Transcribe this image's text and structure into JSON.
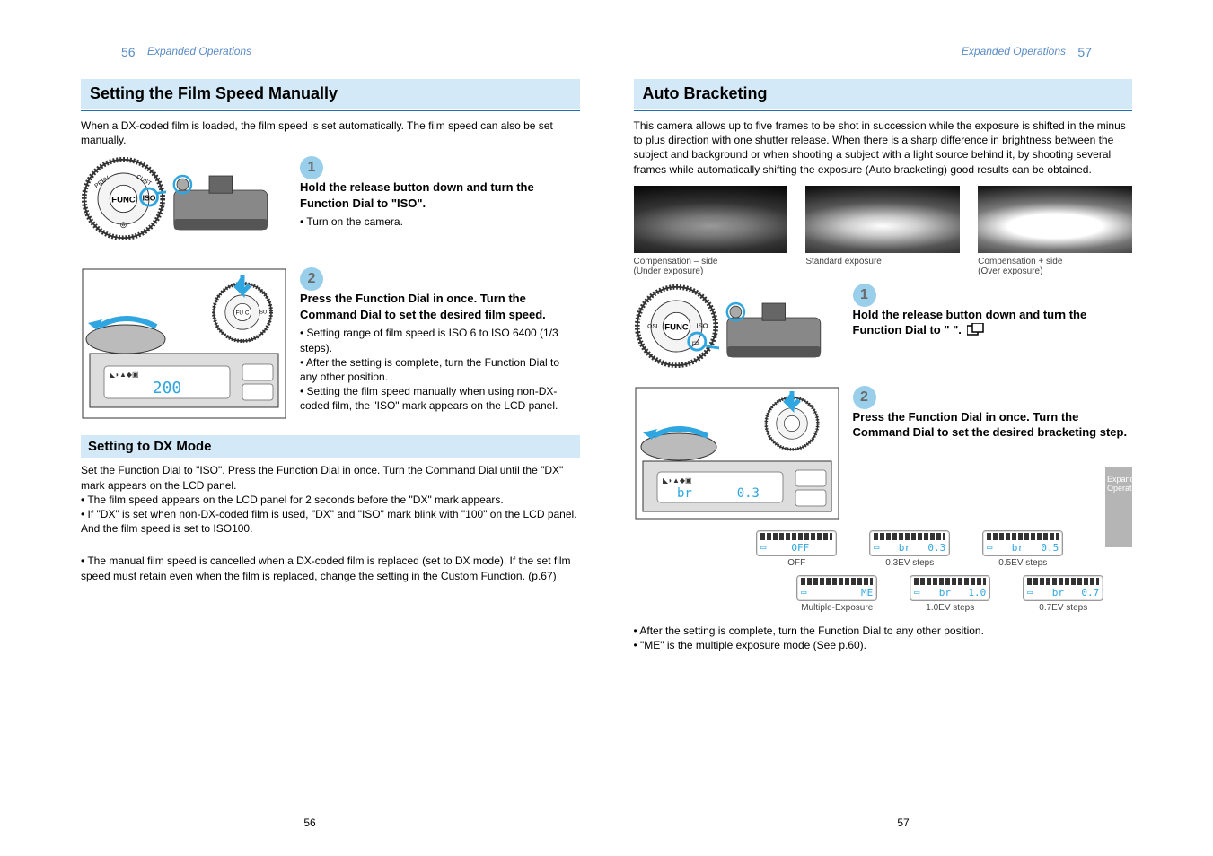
{
  "header": {
    "page_left": "56",
    "page_right": "57",
    "running_left": "Expanded Operations",
    "running_right": "Expanded Operations"
  },
  "tab": {
    "line1": "Expanded",
    "line2": "Operations"
  },
  "left": {
    "title": "Setting the Film Speed Manually",
    "intro": "When a DX-coded film is loaded, the film speed is set automatically. The film speed can also be set manually.",
    "step1": {
      "badge": "1",
      "head": "Hold the release button down and turn the Function Dial to \"ISO\".",
      "body": "• Turn on the camera."
    },
    "step2": {
      "badge": "2",
      "head": "Press the Function Dial in once. Turn the Command Dial to set the desired film speed.",
      "body": "• Setting range of film speed is ISO 6 to ISO 6400 (1/3 steps).\n• After the setting is complete, turn the Function Dial to any other position.\n• Setting the film speed manually when using non-DX-coded film, the \"ISO\" mark appears on the LCD panel.",
      "lcd_value": "200"
    },
    "sub_title": "Setting to DX Mode",
    "sub_body": "Set the Function Dial to \"ISO\". Press the Function Dial in once. Turn the Command Dial until the \"DX\" mark appears on the LCD panel.\n• The film speed appears on the LCD panel for 2 seconds before the \"DX\" mark appears.\n• If \"DX\" is set when non-DX-coded film is used, \"DX\" and \"ISO\" mark blink with \"100\" on the LCD panel. And the film speed is set to ISO100.",
    "note": "• The manual film speed is cancelled when a DX-coded film is replaced (set to DX mode). If the set film speed must retain even when the film is replaced, change the setting in the Custom Function. (p.67)",
    "bottom_page": "56"
  },
  "right": {
    "title": "Auto Bracketing",
    "intro": "This camera allows up to five frames to be shot in succession while the exposure is shifted in the minus to plus direction with one shutter release. When there is a sharp difference in brightness between the subject and background or when shooting a subject with a light source behind it, by shooting several frames while automatically shifting the exposure (Auto bracketing) good results can be obtained.",
    "samples": {
      "a": "Compensation – side\n(Under exposure)",
      "b": "Standard exposure",
      "c": "Compensation + side\n(Over exposure)"
    },
    "step1": {
      "badge": "1",
      "head": "Hold the release button down and turn the Function Dial to \"        \".",
      "icon_name": "bracketing-icon",
      "body": ""
    },
    "step2": {
      "badge": "2",
      "head": "Press the Function Dial in once. Turn the Command Dial to set the desired bracketing step.",
      "body": "",
      "lcd_value": "br   0.3"
    },
    "lcd_options": {
      "off": {
        "left": "OFF",
        "caption": "OFF"
      },
      "b03": {
        "left": "br",
        "right": "0.3",
        "caption": "0.3EV steps"
      },
      "b05": {
        "left": "br",
        "right": "0.5",
        "caption": "0.5EV steps"
      },
      "me": {
        "right": "ME",
        "caption": "Multiple-Exposure"
      },
      "b10": {
        "left": "br",
        "right": "1.0",
        "caption": "1.0EV steps"
      },
      "b07": {
        "left": "br",
        "right": "0.7",
        "caption": "0.7EV steps"
      }
    },
    "foot": "• After the setting is complete, turn the Function Dial to any other position.\n• \"ME\" is the multiple exposure mode (See p.60).",
    "bottom_page": "57"
  }
}
